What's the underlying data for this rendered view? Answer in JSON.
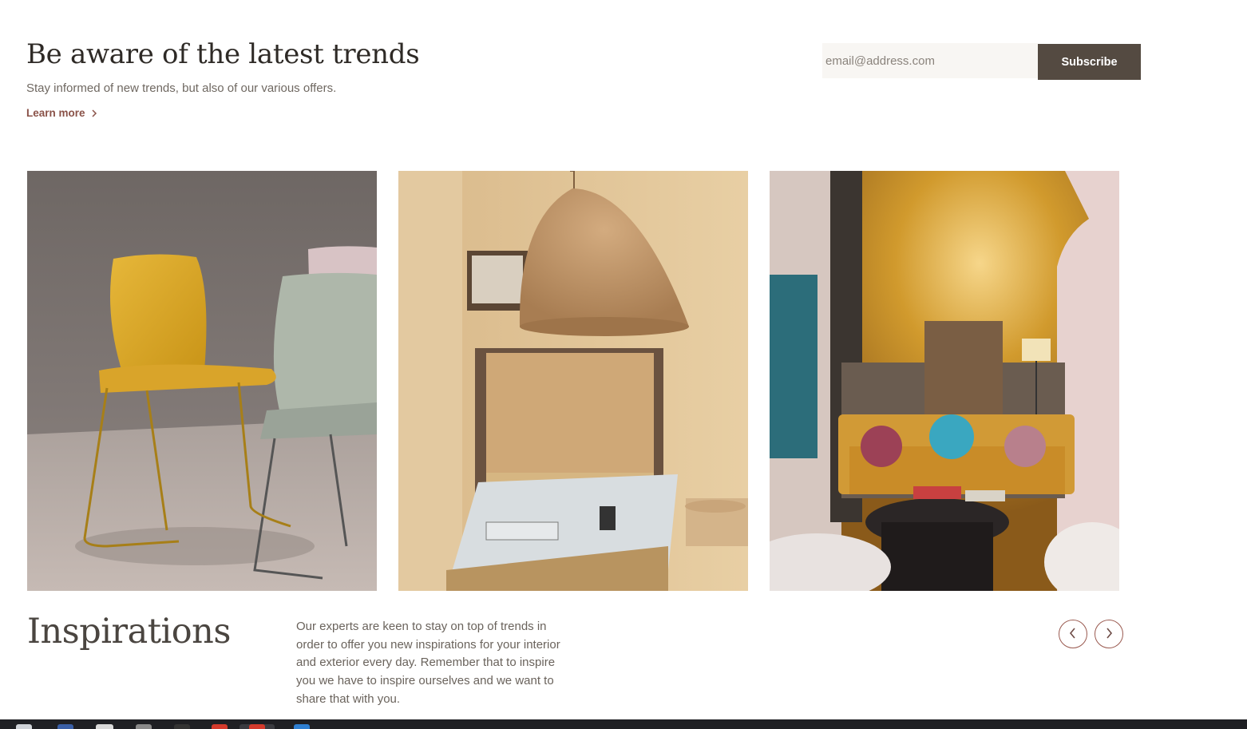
{
  "newsletter": {
    "title": "Be aware of the latest trends",
    "subtitle": "Stay informed of new trends, but also of our various offers.",
    "learn_more": "Learn more",
    "email_placeholder": "email@address.com",
    "subscribe_label": "Subscribe"
  },
  "gallery": {
    "images": [
      {
        "name": "chairs-photo"
      },
      {
        "name": "kitchen-lamp-photo"
      },
      {
        "name": "living-room-photo"
      }
    ]
  },
  "inspirations": {
    "title": "Inspirations",
    "text": "Our experts are keen to stay on top of trends in order to offer you new inspirations for your interior and exterior every day. Remember that to inspire you we have to inspire ourselves and we want to share that with you.",
    "prev_icon": "chevron-left-icon",
    "next_icon": "chevron-right-icon"
  },
  "colors": {
    "accent": "#8a5248",
    "button_bg": "#544a41",
    "nav_border": "#9a5a50"
  }
}
